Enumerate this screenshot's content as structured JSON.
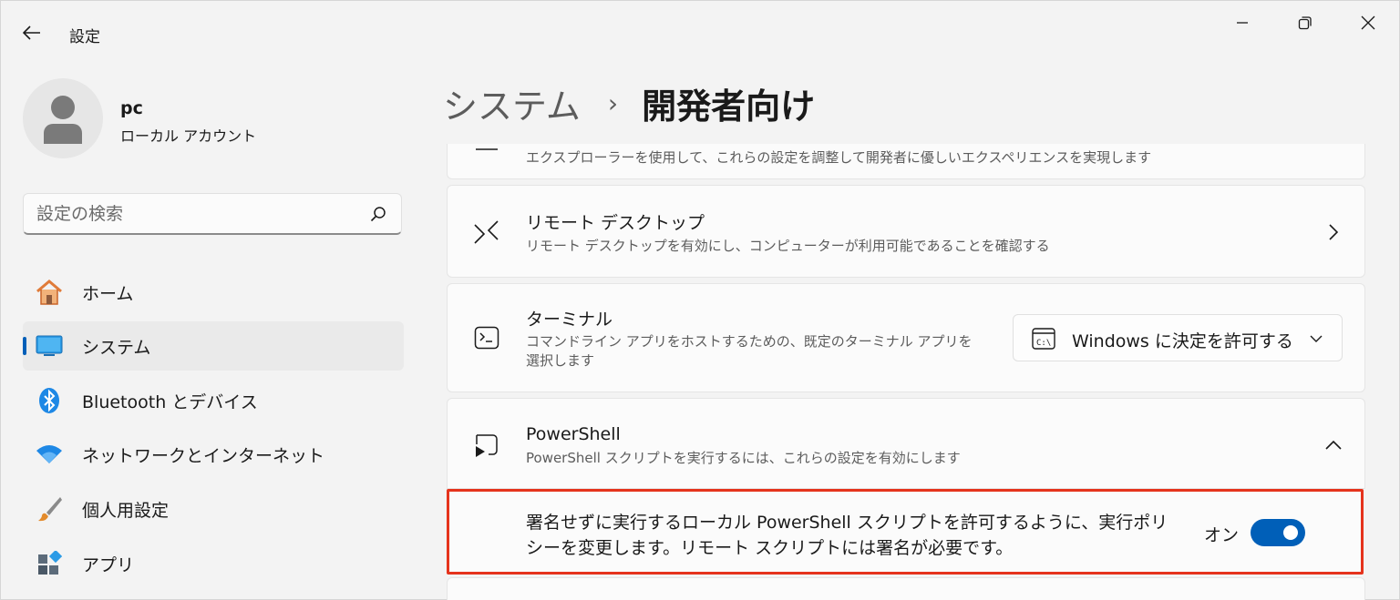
{
  "window": {
    "title": "設定"
  },
  "profile": {
    "name": "pc",
    "account_type": "ローカル アカウント"
  },
  "search": {
    "placeholder": "設定の検索",
    "value": ""
  },
  "sidebar": {
    "items": [
      {
        "label": "ホーム",
        "icon": "home-icon",
        "active": false
      },
      {
        "label": "システム",
        "icon": "system-icon",
        "active": true
      },
      {
        "label": "Bluetooth とデバイス",
        "icon": "bluetooth-icon",
        "active": false
      },
      {
        "label": "ネットワークとインターネット",
        "icon": "wifi-icon",
        "active": false
      },
      {
        "label": "個人用設定",
        "icon": "brush-icon",
        "active": false
      },
      {
        "label": "アプリ",
        "icon": "apps-icon",
        "active": false
      }
    ]
  },
  "header": {
    "parent": "システム",
    "separator": "›",
    "current": "開発者向け"
  },
  "cards": {
    "explorer": {
      "desc": "エクスプローラーを使用して、これらの設定を調整して開発者に優しいエクスペリエンスを実現します"
    },
    "remote_desktop": {
      "title": "リモート デスクトップ",
      "desc": "リモート デスクトップを有効にし、コンピューターが利用可能であることを確認する"
    },
    "terminal": {
      "title": "ターミナル",
      "desc": "コマンドライン アプリをホストするための、既定のターミナル アプリを選択します",
      "dropdown_value": "Windows に決定を許可する"
    },
    "powershell": {
      "title": "PowerShell",
      "desc": "PowerShell スクリプトを実行するには、これらの設定を有効にします",
      "expanded": true,
      "setting": {
        "text": "署名せずに実行するローカル PowerShell スクリプトを許可するように、実行ポリシーを変更します。リモート スクリプトには署名が必要です。",
        "state_label": "オン",
        "enabled": true
      }
    }
  },
  "colors": {
    "accent": "#005fb8",
    "highlight_border": "#e5331c",
    "background": "#f3f3f3",
    "card": "#fbfbfb"
  }
}
